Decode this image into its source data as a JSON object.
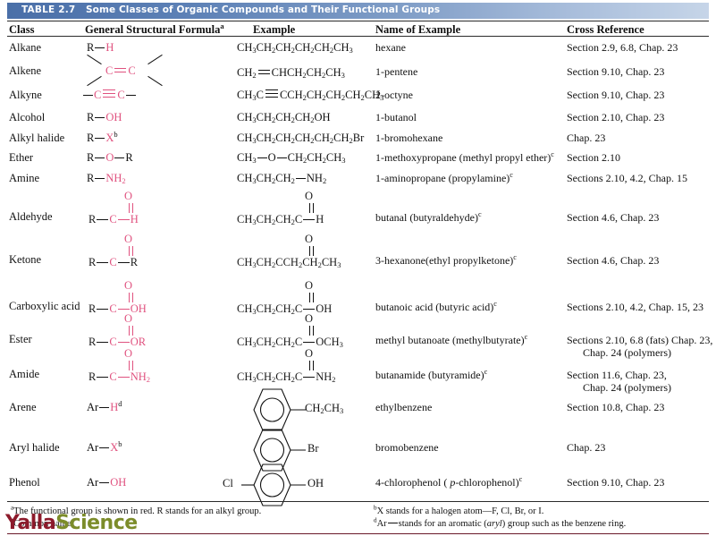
{
  "table": {
    "number_label": "TABLE 2.7",
    "title": "Some Classes of Organic Compounds and Their Functional Groups",
    "columns": {
      "class": "Class",
      "general_structural_formula": "General Structural Formula",
      "general_structural_formula_note": "a",
      "example": "Example",
      "name_of_example": "Name of Example",
      "cross_reference": "Cross Reference"
    },
    "header_gradient_from": "#4a6fa8",
    "header_gradient_to": "#c6d5e8",
    "functional_group_color": "#e0527f"
  },
  "rows": [
    {
      "class": "Alkane",
      "formula_kind": "simple",
      "example_html": "CH3CH2CH2CH2CH2CH3",
      "name": "hexane",
      "xref": "Section 2.9, 6.8, Chap. 23",
      "xref2": ""
    },
    {
      "class": "Alkene",
      "formula_kind": "alkene",
      "example_html": "CH2 = CHCH2CH2CH3",
      "name": "1-pentene",
      "xref": "Section 9.10, Chap. 23",
      "xref2": ""
    },
    {
      "class": "Alkyne",
      "formula_kind": "alkyne",
      "example_html": "CH3C ≡ CCH2CH2CH2CH2CH3",
      "name": "2-octyne",
      "xref": "Section 9.10, Chap. 23",
      "xref2": ""
    },
    {
      "class": "Alcohol",
      "formula_kind": "simple",
      "name": "1-butanol",
      "xref": "Section 2.10, Chap. 23",
      "xref2": ""
    },
    {
      "class": "Alkyl halide",
      "formula_kind": "simple",
      "name": "1-bromohexane",
      "xref": "Chap. 23",
      "xref2": ""
    },
    {
      "class": "Ether",
      "formula_kind": "simple",
      "name": "1-methoxypropane (methyl propyl ether)",
      "name_note": "c",
      "xref": "Section 2.10",
      "xref2": ""
    },
    {
      "class": "Amine",
      "formula_kind": "simple",
      "name": "1-aminopropane (propylamine)",
      "name_note": "c",
      "xref": "Sections 2.10, 4.2, Chap. 15",
      "xref2": ""
    },
    {
      "class": "Aldehyde",
      "formula_kind": "carbonyl",
      "name": "butanal  (butyraldehyde)",
      "name_note": "c",
      "xref": "Section 4.6, Chap. 23",
      "xref2": ""
    },
    {
      "class": "Ketone",
      "formula_kind": "carbonyl",
      "name": "3-hexanone(ethyl propylketone)",
      "name_note": "c",
      "xref": "Section 4.6, Chap. 23",
      "xref2": ""
    },
    {
      "class": "Carboxylic acid",
      "formula_kind": "carbonyl",
      "name": "butanoic acid  (butyric acid)",
      "name_note": "c",
      "xref": "Sections 2.10, 4.2,  Chap. 15, 23",
      "xref2": ""
    },
    {
      "class": "Ester",
      "formula_kind": "carbonyl",
      "name": "methyl butanoate (methylbutyrate)",
      "name_note": "c",
      "xref": "Sections 2.10, 6.8 (fats) Chap. 23,",
      "xref2": "Chap. 24 (polymers)"
    },
    {
      "class": "Amide",
      "formula_kind": "carbonyl",
      "name": "butanamide (butyramide)",
      "name_note": "c",
      "xref": "Section 11.6, Chap. 23,",
      "xref2": "Chap. 24 (polymers)"
    },
    {
      "class": "Arene",
      "formula_kind": "aryl",
      "name": "ethylbenzene",
      "xref": "Section 10.8, Chap. 23",
      "xref2": ""
    },
    {
      "class": "Aryl halide",
      "formula_kind": "aryl",
      "name": "bromobenzene",
      "xref": "Chap. 23",
      "xref2": ""
    },
    {
      "class": "Phenol",
      "formula_kind": "aryl",
      "name": "4-chlorophenol ( p-chlorophenol)",
      "name_note": "c",
      "xref": "Section 9.10, Chap. 23",
      "xref2": ""
    }
  ],
  "formulas": {
    "alkane": {
      "r": "R",
      "h": "H"
    },
    "alcohol": {
      "r": "R",
      "group": "OH"
    },
    "alkyl_halide": {
      "r": "R",
      "group": "X",
      "note": "b"
    },
    "ether": {
      "r": "R",
      "group": "O",
      "r2": "R"
    },
    "amine": {
      "r": "R",
      "group": "NH",
      "sub": "2"
    },
    "aldehyde": {
      "r": "R",
      "oxy": "O",
      "c": "C",
      "group": "H"
    },
    "ketone": {
      "r": "R",
      "oxy": "O",
      "c": "C",
      "group": "R"
    },
    "carboxylic_acid": {
      "r": "R",
      "oxy": "O",
      "c": "C",
      "group": "OH"
    },
    "ester": {
      "r": "R",
      "oxy": "O",
      "c": "C",
      "group": "OR"
    },
    "amide": {
      "r": "R",
      "oxy": "O",
      "c": "C",
      "group": "NH",
      "sub": "2"
    },
    "arene": {
      "ar": "Ar",
      "group": "H",
      "note": "d"
    },
    "aryl_halide": {
      "ar": "Ar",
      "group": "X",
      "note": "b"
    },
    "phenol": {
      "ar": "Ar",
      "group": "OH"
    },
    "alkene": {
      "c1": "C",
      "c2": "C"
    },
    "alkyne": {
      "c1": "C",
      "c2": "C"
    }
  },
  "examples": {
    "alkane": "CH3CH2CH2CH2CH2CH3",
    "alkene": "CH2=CHCH2CH2CH3",
    "alkyne": "CH3C≡CCH2CH2CH2CH2CH3",
    "alcohol": "CH3CH2CH2CH2OH",
    "alkyl_halide": "CH3CH2CH2CH2CH2CH2Br",
    "ether": "CH3—O—CH2CH2CH3",
    "amine": "CH3CH2CH2—NH2",
    "aldehyde": "CH3CH2CH2C—H",
    "ketone": "CH3CH2CCH2CH2CH3",
    "carboxylic_acid": "CH3CH2CH2C—OH",
    "ester": "CH3CH2CH2C—OCH3",
    "amide": "CH3CH2CH2C—NH2",
    "arene": "CH2CH3",
    "aryl_halide": "Br",
    "phenol_left": "Cl",
    "phenol_right": "OH",
    "carbonyl_oxygen": "O"
  },
  "footnotes": {
    "a": "The functional group is shown in red. R stands for an alkyl group.",
    "a_mark": "a",
    "b": "X stands for a halogen atom—F, Cl, Br, or I.",
    "b_mark": "b",
    "c": "Common name.",
    "c_mark": "c",
    "d": "Ar— stands for an aromatic (aryl) group such as the benzene ring.",
    "d_mark": "d"
  },
  "watermark": {
    "part1": "Yalla",
    "part2": "Science",
    "color1": "#8c1a2b",
    "color2": "#7c8c2a"
  }
}
